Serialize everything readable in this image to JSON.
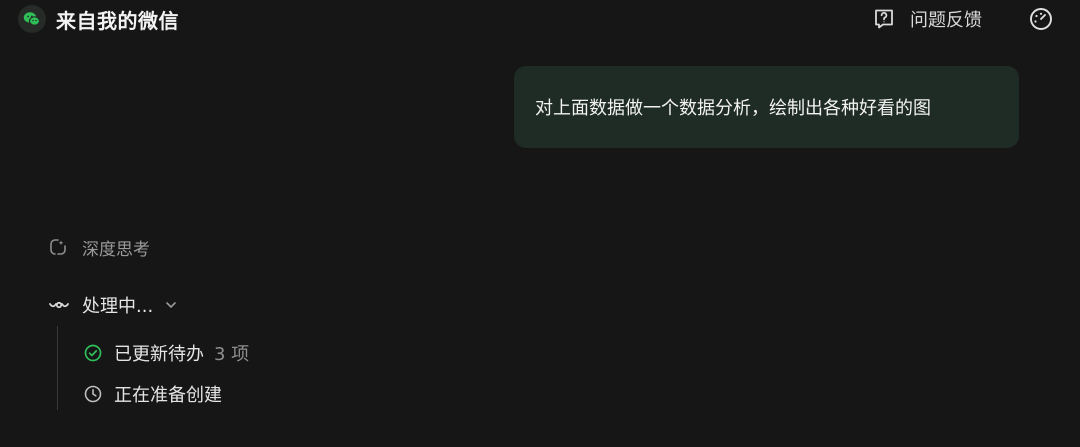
{
  "header": {
    "title": "来自我的微信",
    "feedback_label": "问题反馈",
    "icons": [
      "wechat-icon",
      "question-box-icon",
      "gauge-icon"
    ]
  },
  "chat": {
    "user_message": "对上面数据做一个数据分析，绘制出各种好看的图"
  },
  "process": {
    "thinking_label": "深度思考",
    "status_label": "处理中...",
    "steps": [
      {
        "label": "已更新待办",
        "count": "3 项",
        "icon": "check-circle-icon",
        "done": true
      },
      {
        "label": "正在准备创建",
        "icon": "clock-icon",
        "done": false
      }
    ]
  },
  "colors": {
    "background": "#161616",
    "bubble": "#1f2b25",
    "accent_green": "#2fbf59"
  }
}
